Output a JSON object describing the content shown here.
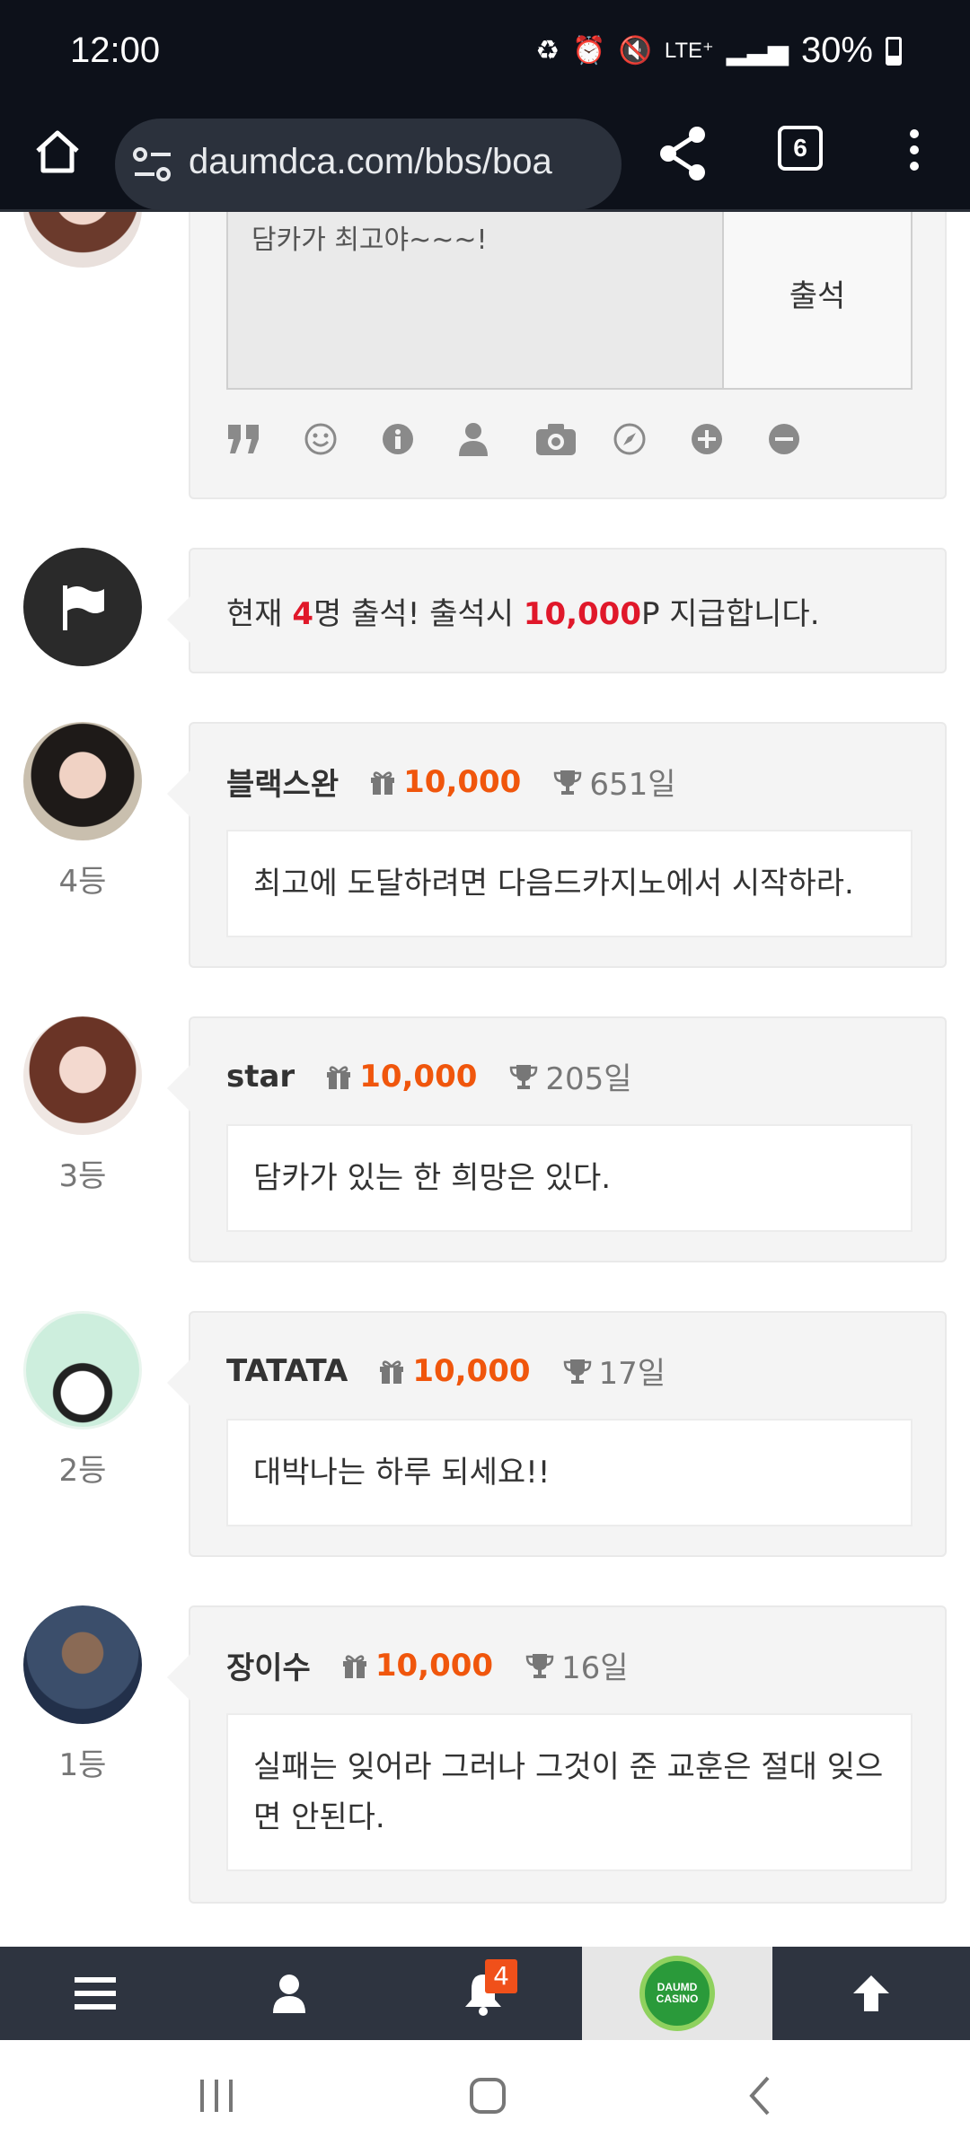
{
  "status_bar": {
    "time": "12:00",
    "network": "LTE⁺",
    "battery": "30%"
  },
  "browser": {
    "url": "daumdca.com/bbs/boa",
    "tab_count": "6"
  },
  "compose": {
    "text": "담카가 최고야~~~!",
    "submit_label": "출석",
    "tools": [
      "quote-icon",
      "emoji-icon",
      "info-icon",
      "user-icon",
      "camera-icon",
      "link-icon",
      "plus-icon",
      "minus-icon"
    ]
  },
  "notice": {
    "prefix": "현재 ",
    "count": "4",
    "middle": "명 출석! 출석시 ",
    "points": "10,000",
    "suffix": "P 지급합니다."
  },
  "entries": [
    {
      "rank": "4등",
      "name": "블랙스완",
      "points": "10,000",
      "days": "651일",
      "message": "최고에 도달하려면 다음드카지노에서 시작하라."
    },
    {
      "rank": "3등",
      "name": "star",
      "points": "10,000",
      "days": "205일",
      "message": "담카가 있는 한 희망은 있다."
    },
    {
      "rank": "2등",
      "name": "TATATA",
      "points": "10,000",
      "days": "17일",
      "message": "대박나는 하루 되세요!!"
    },
    {
      "rank": "1등",
      "name": "장이수",
      "points": "10,000",
      "days": "16일",
      "message": "실패는 잊어라 그러나 그것이 준 교훈은 절대 잊으면 안된다."
    }
  ],
  "bottom_nav": {
    "notification_count": "4",
    "logo_text": "DAUMD CASINO"
  },
  "colors": {
    "accent_red": "#e0182a",
    "points_orange": "#f0560c",
    "nav_bg": "#2e3440"
  }
}
